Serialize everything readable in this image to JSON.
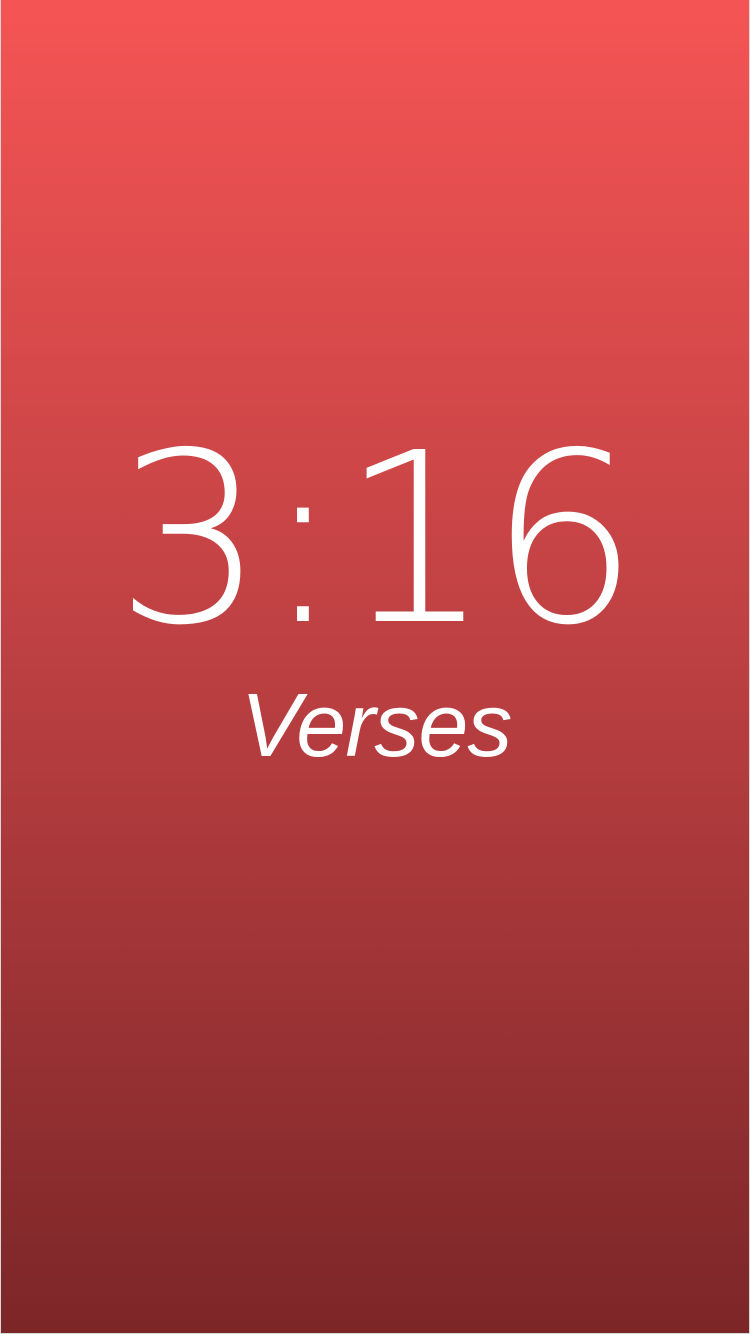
{
  "splash": {
    "time_text": "3:16",
    "app_name": "Verses"
  },
  "colors": {
    "gradient_top": "#f55454",
    "gradient_bottom": "#7c2628",
    "text": "#ffffff"
  }
}
